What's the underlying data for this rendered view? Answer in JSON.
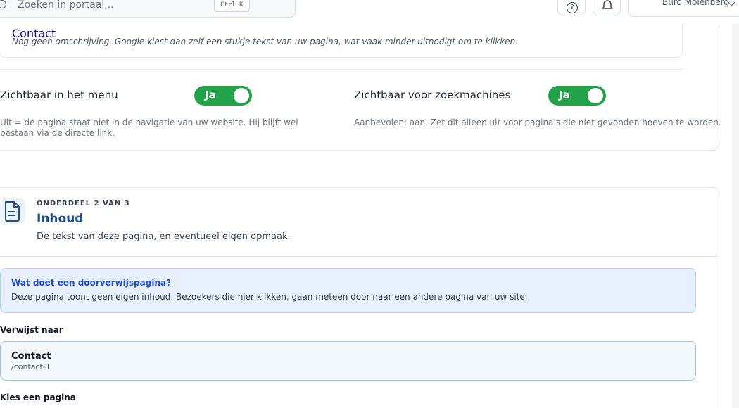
{
  "header": {
    "search_placeholder": "Zoeken in portaal...",
    "shortcut": "Ctrl K",
    "help_icon": "help-circle-icon",
    "bell_icon": "bell-icon",
    "account_name": "Buro Molenberg"
  },
  "seo_preview": {
    "title": "Contact",
    "description": "Nog geen omschrijving. Google kiest dan zelf een stukje tekst van uw pagina, wat vaak minder uitnodigt om te klikken."
  },
  "options": [
    {
      "label": "Zichtbaar in het menu",
      "toggle_text": "Ja",
      "toggle_on": true,
      "help": "Uit = de pagina staat niet in de navigatie van uw website. Hij blijft wel bestaan via de directe link."
    },
    {
      "label": "Zichtbaar voor zoekmachines",
      "toggle_text": "Ja",
      "toggle_on": true,
      "help": "Aanbevolen: aan. Zet dit alleen uit voor pagina's die niet gevonden hoeven te worden."
    }
  ],
  "section": {
    "eyebrow": "ONDERDEEL 2 VAN 3",
    "title": "Inhoud",
    "subtitle": "De tekst van deze pagina, en eventueel eigen opmaak.",
    "icon": "document-icon"
  },
  "info_box": {
    "title": "Wat doet een doorverwijspagina?",
    "body": "Deze pagina toont geen eigen inhoud. Bezoekers die hier klikken, gaan meteen door naar een andere pagina van uw site."
  },
  "redirect": {
    "label": "Verwijst naar",
    "target_title": "Contact",
    "target_path": "/contact-1"
  },
  "picker": {
    "label": "Kies een pagina"
  },
  "colors": {
    "toggle_on": "#22a34a",
    "section_title": "#1e4f8c",
    "info_bg": "#e8f0fd",
    "info_title": "#1d4ed8",
    "link_blue": "#1a0dab"
  }
}
